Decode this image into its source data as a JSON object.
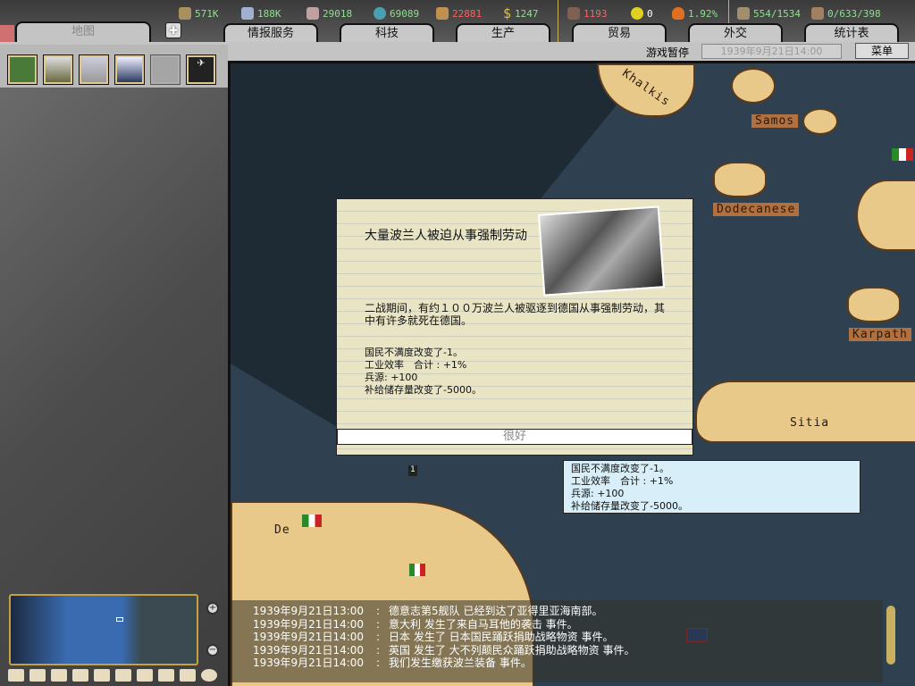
{
  "resources": [
    {
      "name": "energy",
      "value": "571K",
      "color": "#8fe08f"
    },
    {
      "name": "metal",
      "value": "188K",
      "color": "#8fe08f"
    },
    {
      "name": "rare-materials",
      "value": "29018",
      "color": "#8fe08f"
    },
    {
      "name": "oil",
      "value": "69089",
      "color": "#8fe08f"
    },
    {
      "name": "supplies",
      "value": "22881",
      "color": "#ff6060"
    },
    {
      "name": "money",
      "value": "1247",
      "color": "#8fe08f"
    },
    {
      "name": "manpower",
      "value": "1193",
      "color": "#ff6060"
    },
    {
      "name": "nuclear",
      "value": "0",
      "color": "#ffffff"
    },
    {
      "name": "dissent",
      "value": "1.92%",
      "color": "#8fe08f"
    },
    {
      "name": "transports",
      "value": "554/1534",
      "color": "#8fe08f"
    },
    {
      "name": "convoys",
      "value": "0/633/398",
      "color": "#8fe08f"
    }
  ],
  "tabs": {
    "map": "地图",
    "intel": "情报服务",
    "tech": "科技",
    "production": "生产",
    "trade": "贸易",
    "diplomacy": "外交",
    "stats": "统计表"
  },
  "status": {
    "paused": "游戏暂停",
    "date": "1939年9月21日14:00",
    "menu": "菜单"
  },
  "map_labels": [
    "Khalkis",
    "Samos",
    "Dodecanese",
    "Karpath",
    "Sitia",
    "De"
  ],
  "event": {
    "title": "大量波兰人被迫从事强制劳动",
    "body": "二战期间，有约１００万波兰人被驱逐到德国从事强制劳动，其中有许多就死在德国。",
    "effects": [
      "国民不满度改变了-1。",
      "工业效率　合计 : +1%",
      "兵源: +100",
      "补给储存量改变了-5000。"
    ],
    "ok": "很好"
  },
  "tooltip": [
    "国民不满度改变了-1。",
    "工业效率　合计 : +1%",
    "兵源: +100",
    "补给储存量改变了-5000。"
  ],
  "unit_count": "1",
  "log": [
    {
      "date": "1939年9月21日13:00",
      "text": "德意志第5舰队 已经到达了亚得里亚海南部。"
    },
    {
      "date": "1939年9月21日14:00",
      "text": "意大利 发生了来自马耳他的袭击 事件。"
    },
    {
      "date": "1939年9月21日14:00",
      "text": "日本 发生了 日本国民踊跃捐助战略物资 事件。"
    },
    {
      "date": "1939年9月21日14:00",
      "text": "英国 发生了 大不列颠民众踊跃捐助战略物资 事件。"
    },
    {
      "date": "1939年9月21日14:00",
      "text": "我们发生缴获波兰装备 事件。"
    }
  ]
}
